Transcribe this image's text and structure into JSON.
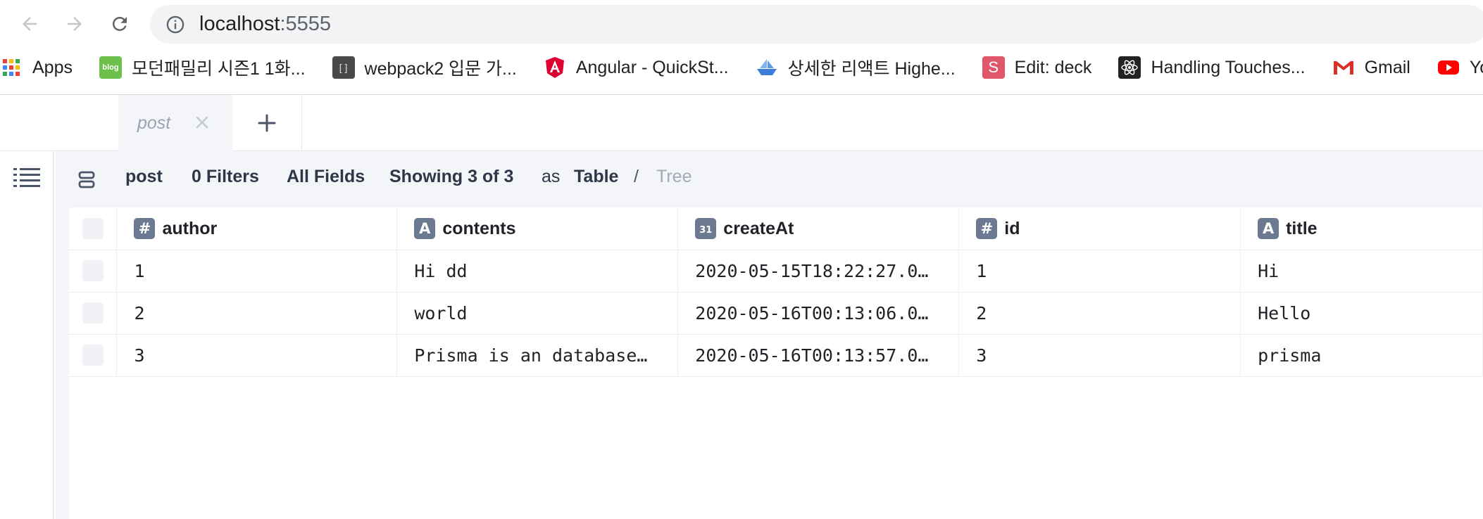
{
  "browser": {
    "url_host": "localhost",
    "url_port": ":5555",
    "bookmarks": [
      {
        "label": "Apps",
        "icon": "apps-grid-icon"
      },
      {
        "label": "모던패밀리 시즌1 1화...",
        "icon": "blog-icon"
      },
      {
        "label": "webpack2 입문 가...",
        "icon": "webpack-icon"
      },
      {
        "label": "Angular - QuickSt...",
        "icon": "angular-icon"
      },
      {
        "label": "상세한 리액트 Highe...",
        "icon": "boat-icon"
      },
      {
        "label": "Edit: deck",
        "icon": "slides-icon"
      },
      {
        "label": "Handling Touches...",
        "icon": "react-icon"
      },
      {
        "label": "Gmail",
        "icon": "gmail-icon"
      },
      {
        "label": "Yo",
        "icon": "youtube-icon"
      }
    ]
  },
  "tabs": {
    "active_label": "post"
  },
  "toolbar": {
    "model": "post",
    "filters": "0 Filters",
    "fields": "All Fields",
    "showing": "Showing 3 of 3",
    "as_label": "as",
    "view_table": "Table",
    "separator": "/",
    "view_tree": "Tree"
  },
  "table": {
    "columns": [
      {
        "name": "author",
        "type_glyph": "#"
      },
      {
        "name": "contents",
        "type_glyph": "A"
      },
      {
        "name": "createAt",
        "type_glyph": "31"
      },
      {
        "name": "id",
        "type_glyph": "#"
      },
      {
        "name": "title",
        "type_glyph": "A"
      }
    ],
    "rows": [
      {
        "author": "1",
        "contents": "Hi dd",
        "createAt": "2020-05-15T18:22:27.0…",
        "id": "1",
        "title": "Hi"
      },
      {
        "author": "2",
        "contents": "world",
        "createAt": "2020-05-16T00:13:06.0…",
        "id": "2",
        "title": "Hello"
      },
      {
        "author": "3",
        "contents": "Prisma is an database…",
        "createAt": "2020-05-16T00:13:57.0…",
        "id": "3",
        "title": "prisma"
      }
    ]
  },
  "colors": {
    "badge": "#6b7a90",
    "workarea_bg": "#f3f5f8",
    "muted_text": "#a0aab8"
  }
}
